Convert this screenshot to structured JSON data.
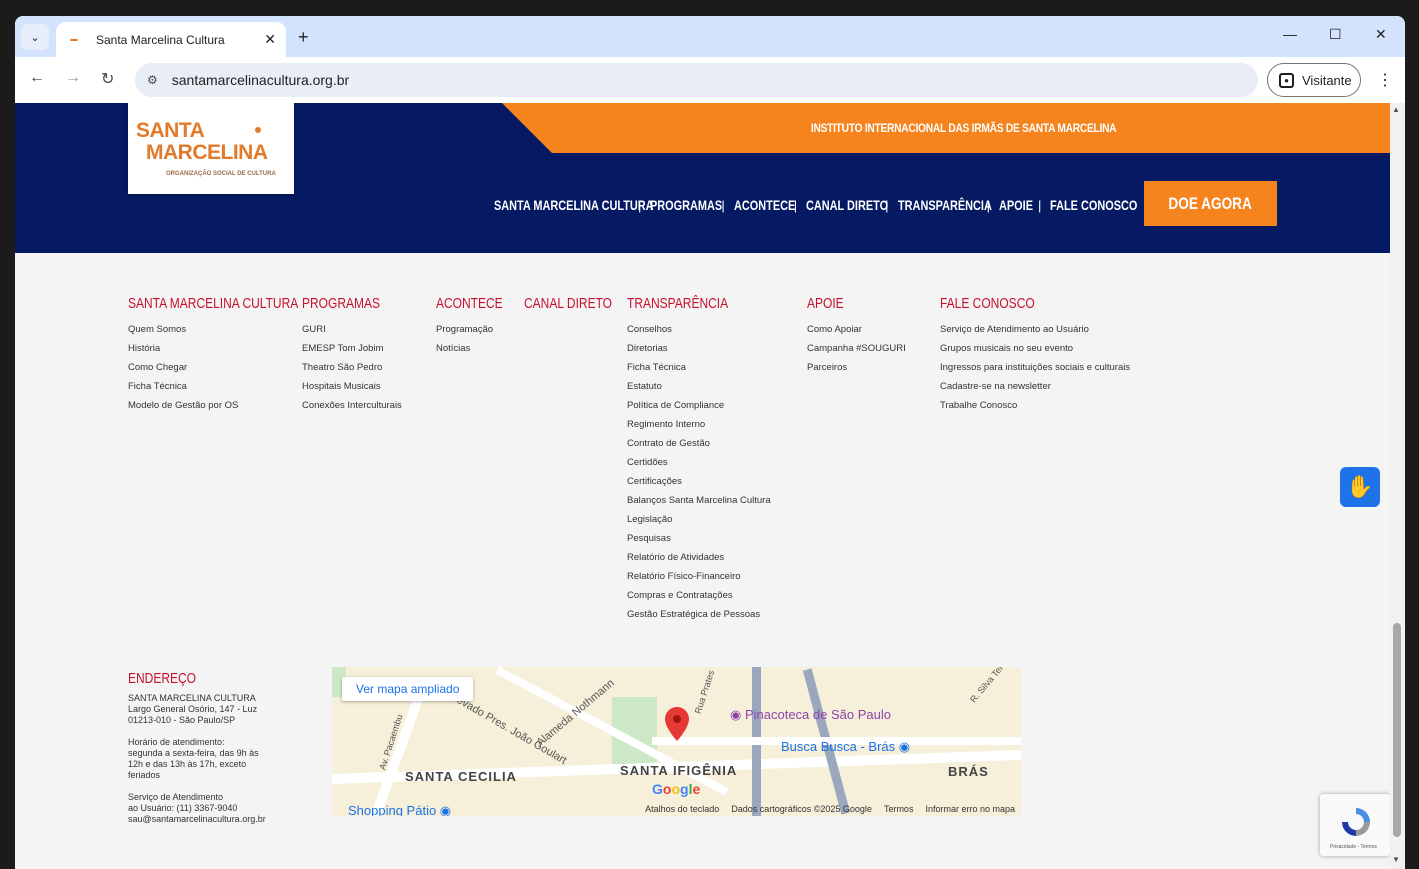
{
  "browser": {
    "tab_title": "Santa Marcelina Cultura",
    "url": "santamarcelinacultura.org.br",
    "profile_label": "Visitante"
  },
  "header": {
    "institute": "INSTITUTO INTERNACIONAL DAS IRMÃS DE SANTA MARCELINA",
    "logo_line1": "SANTA",
    "logo_line2": "MARCELINA",
    "logo_sub": "ORGANIZAÇÃO SOCIAL DE CULTURA",
    "nav": [
      "SANTA MARCELINA CULTURA",
      "PROGRAMAS",
      "ACONTECE",
      "CANAL DIRETO",
      "TRANSPARÊNCIA",
      "APOIE",
      "FALE CONOSCO"
    ],
    "nav_sep": "|",
    "donate": "DOE AGORA"
  },
  "footer": {
    "columns": [
      {
        "title": "SANTA MARCELINA CULTURA",
        "items": [
          "Quem Somos",
          "História",
          "Como Chegar",
          "Ficha Técnica",
          "Modelo de Gestão por OS"
        ]
      },
      {
        "title": "PROGRAMAS",
        "items": [
          "GURI",
          "EMESP Tom Jobim",
          "Theatro São Pedro",
          "Hospitais Musicais",
          "Conexões Interculturais"
        ]
      },
      {
        "title": "ACONTECE",
        "items": [
          "Programação",
          "Notícias"
        ]
      },
      {
        "title": "CANAL DIRETO",
        "items": []
      },
      {
        "title": "TRANSPARÊNCIA",
        "items": [
          "Conselhos",
          "Diretorias",
          "Ficha Técnica",
          "Estatuto",
          "Política de Compliance",
          "Regimento Interno",
          "Contrato de Gestão",
          "Certidões",
          "Certificações",
          "Balanços Santa Marcelina Cultura",
          "Legislação",
          "Pesquisas",
          "Relatório de Atividades",
          "Relatório Físico-Financeiro",
          "Compras e Contratações",
          "Gestão Estratégica de Pessoas"
        ]
      },
      {
        "title": "APOIE",
        "items": [
          "Como Apoiar",
          "Campanha #SOUGURI",
          "Parceiros"
        ]
      },
      {
        "title": "FALE CONOSCO",
        "items": [
          "Serviço de Atendimento ao Usuário",
          "Grupos musicais no seu evento",
          "Ingressos para instituições sociais e culturais",
          "Cadastre-se na newsletter",
          "Trabalhe Conosco"
        ]
      }
    ],
    "address": {
      "title": "ENDEREÇO",
      "org": "SANTA MARCELINA CULTURA",
      "street": "Largo General Osório, 147 - Luz",
      "cep": "01213-010 - São Paulo/SP",
      "hours_1": "Horário de atendimento:",
      "hours_2": "segunda a sexta-feira, das 9h às",
      "hours_3": "12h e das 13h às 17h, exceto",
      "hours_4": "feriados",
      "sau_1": "Serviço de Atendimento",
      "sau_2": "ao Usuário: (11) 3367-9040",
      "sau_3": "sau@santamarcelinacultura.org.br"
    }
  },
  "map": {
    "ampliado": "Ver mapa ampliado",
    "poi_pinacoteca": "Pinacoteca de São Paulo",
    "poi_busca": "Busca Busca - Brás",
    "poi_shopping": "Shopping Pátio",
    "area_cecilia": "SANTA CECILIA",
    "area_ifigenia": "SANTA IFIGÊNIA",
    "area_bras": "BRÁS",
    "street_nothmann": "Alameda Nothmann",
    "street_goulart": "Elevado Pres. João Goulart",
    "street_pacaembu": "Av. Pacaembu",
    "street_prates": "Rua Prates",
    "street_silva": "R. Silva Tel",
    "google": "Google",
    "shortcuts": "Atalhos do teclado",
    "copyright": "Dados cartográficos ©2025 Google",
    "terms": "Termos",
    "report": "Informar erro no mapa"
  },
  "recaptcha": {
    "text": "Privacidade - Termos"
  }
}
